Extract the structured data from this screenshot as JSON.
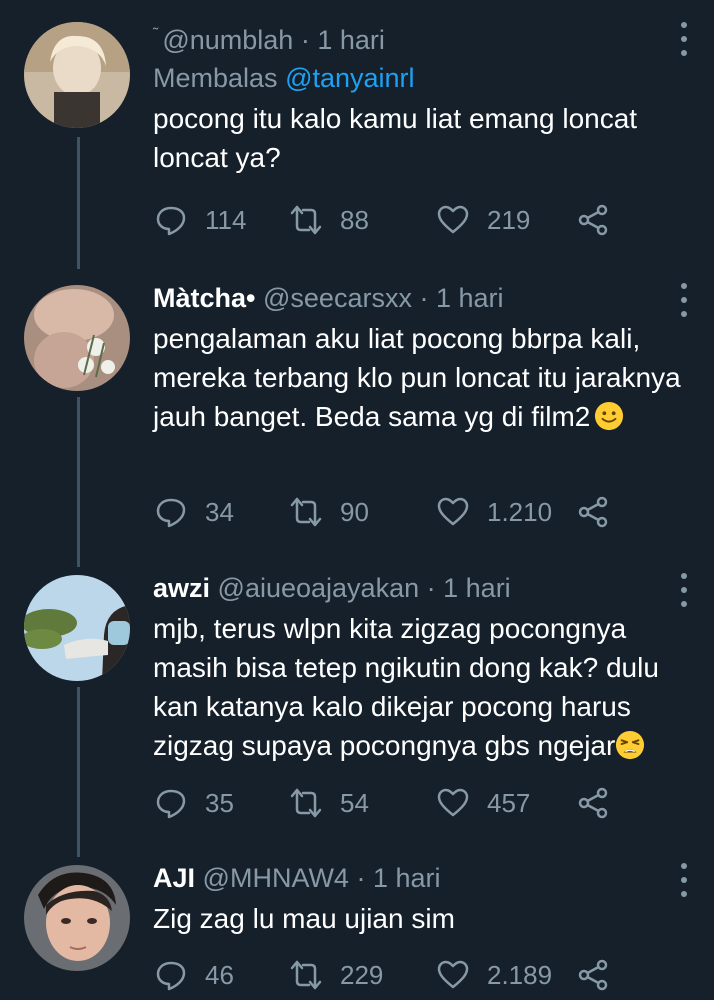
{
  "tweets": [
    {
      "name": "",
      "handle_prefix": "˜",
      "handle": "@numblah",
      "time": "1 hari",
      "replying_to_label": "Membalas",
      "replying_to_handle": "@tanyainrl",
      "text": "pocong itu kalo kamu liat emang loncat loncat ya?",
      "replies": "114",
      "retweets": "88",
      "likes": "219"
    },
    {
      "name": "Màtcha•",
      "handle": "@seecarsxx",
      "time": "1 hari",
      "text": "pengalaman aku liat pocong bbrpa kali, mereka terbang klo pun loncat itu jaraknya jauh banget. Beda sama yg di film2",
      "emoji": "slightly-smiling-face",
      "replies": "34",
      "retweets": "90",
      "likes": "1.210"
    },
    {
      "name": "awzi",
      "handle": "@aiueoajayakan",
      "time": "1 hari",
      "text": "mjb, terus wlpn kita zigzag pocongnya masih bisa tetep ngikutin dong kak? dulu kan katanya kalo dikejar pocong harus zigzag supaya pocongnya gbs ngejar",
      "emoji": "tired-face",
      "replies": "35",
      "retweets": "54",
      "likes": "457"
    },
    {
      "name": "AJI",
      "handle": "@MHNAW4",
      "time": "1 hari",
      "text": "Zig zag lu mau ujian sim",
      "replies": "46",
      "retweets": "229",
      "likes": "2.189"
    }
  ],
  "separator": "·",
  "icons": {
    "reply": "reply-icon",
    "retweet": "retweet-icon",
    "like": "heart-icon",
    "share": "share-icon",
    "more": "more-icon"
  },
  "colors": {
    "background": "#15202b",
    "muted": "#8899a6",
    "mention": "#1da1f2",
    "thread_line": "#3d5466"
  }
}
